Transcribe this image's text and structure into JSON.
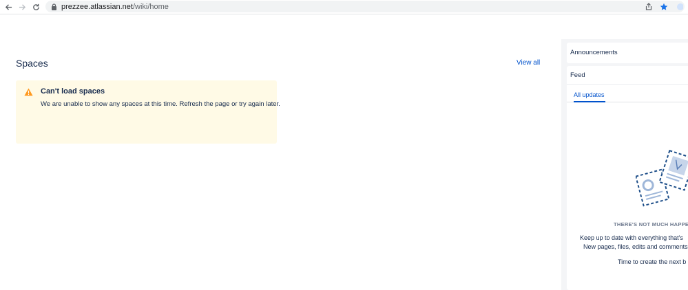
{
  "browser": {
    "url_host": "prezzee.atlassian.net",
    "url_path": "/wiki/home",
    "icons": [
      "back-icon",
      "forward-icon",
      "reload-icon",
      "lock-icon",
      "share-icon",
      "star-icon"
    ]
  },
  "spaces": {
    "title": "Spaces",
    "view_all": "View all",
    "warning": {
      "title": "Can't load spaces",
      "message": "We are unable to show any spaces at this time. Refresh the page or try again later.",
      "color": "#FF991F"
    }
  },
  "sidebar": {
    "announcements": "Announcements",
    "feed": {
      "title": "Feed",
      "tab": "All updates",
      "empty_heading": "THERE'S NOT MUCH HAPPEN",
      "empty_line1": "Keep up to date with everything that's",
      "empty_line2": "New pages, files, edits and comments",
      "empty_line3": "Time to create the next b"
    }
  },
  "colors": {
    "link": "#0052CC",
    "warning_bg": "#FFFAE6",
    "panel_bg": "#F4F5F7"
  }
}
